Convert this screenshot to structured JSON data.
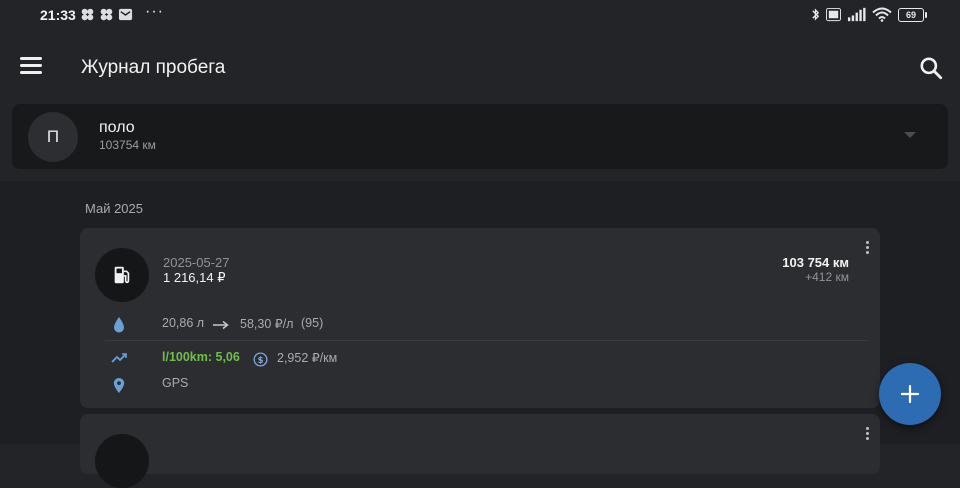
{
  "status_bar": {
    "time": "21:33",
    "more": "···",
    "battery": "69"
  },
  "app_bar": {
    "title": "Журнал пробега"
  },
  "vehicle": {
    "avatar_letter": "П",
    "name": "поло",
    "odometer": "103754 км"
  },
  "log": {
    "month": "Май 2025",
    "entries": [
      {
        "date": "2025-05-27",
        "cost": "1 216,14 ₽",
        "odometer": "103 754 км",
        "delta": "+412 км",
        "volume": "20,86 л",
        "price": "58,30 ₽/л",
        "fuel_grade": "(95)",
        "efficiency": "l/100km: 5,06",
        "cost_per_km": "2,952 ₽/км",
        "location": "GPS"
      }
    ]
  },
  "colors": {
    "background": "#232427",
    "card": "#2c2d30",
    "accent": "#2d6bb3",
    "efficiency_green": "#6fbf4a",
    "icon_blue": "#6a9fd8"
  }
}
